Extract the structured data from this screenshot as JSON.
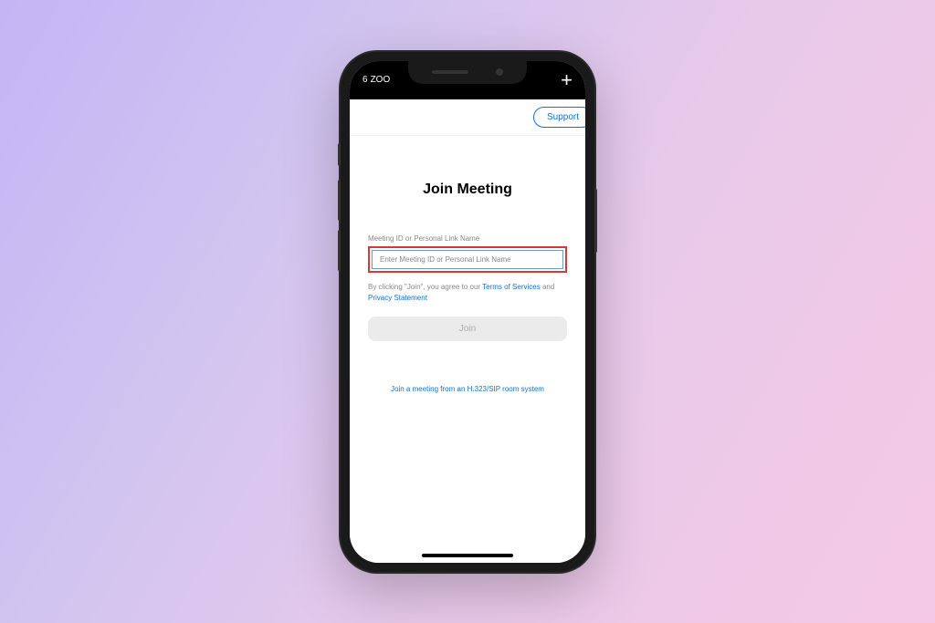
{
  "status": {
    "partial_text": "6",
    "brand_text": "ZOO"
  },
  "header": {
    "support_label": "Support"
  },
  "main": {
    "title": "Join Meeting",
    "input_label": "Meeting ID or Personal Link Name",
    "input_placeholder": "Enter Meeting ID or Personal Link Name",
    "agreement_prefix": "By clicking \"Join\", you agree to our ",
    "terms_label": "Terms of Services",
    "agreement_conjunction": " and ",
    "privacy_label": "Privacy Statement",
    "join_button_label": "Join",
    "sip_link_label": "Join a meeting from an H.323/SIP room system"
  }
}
